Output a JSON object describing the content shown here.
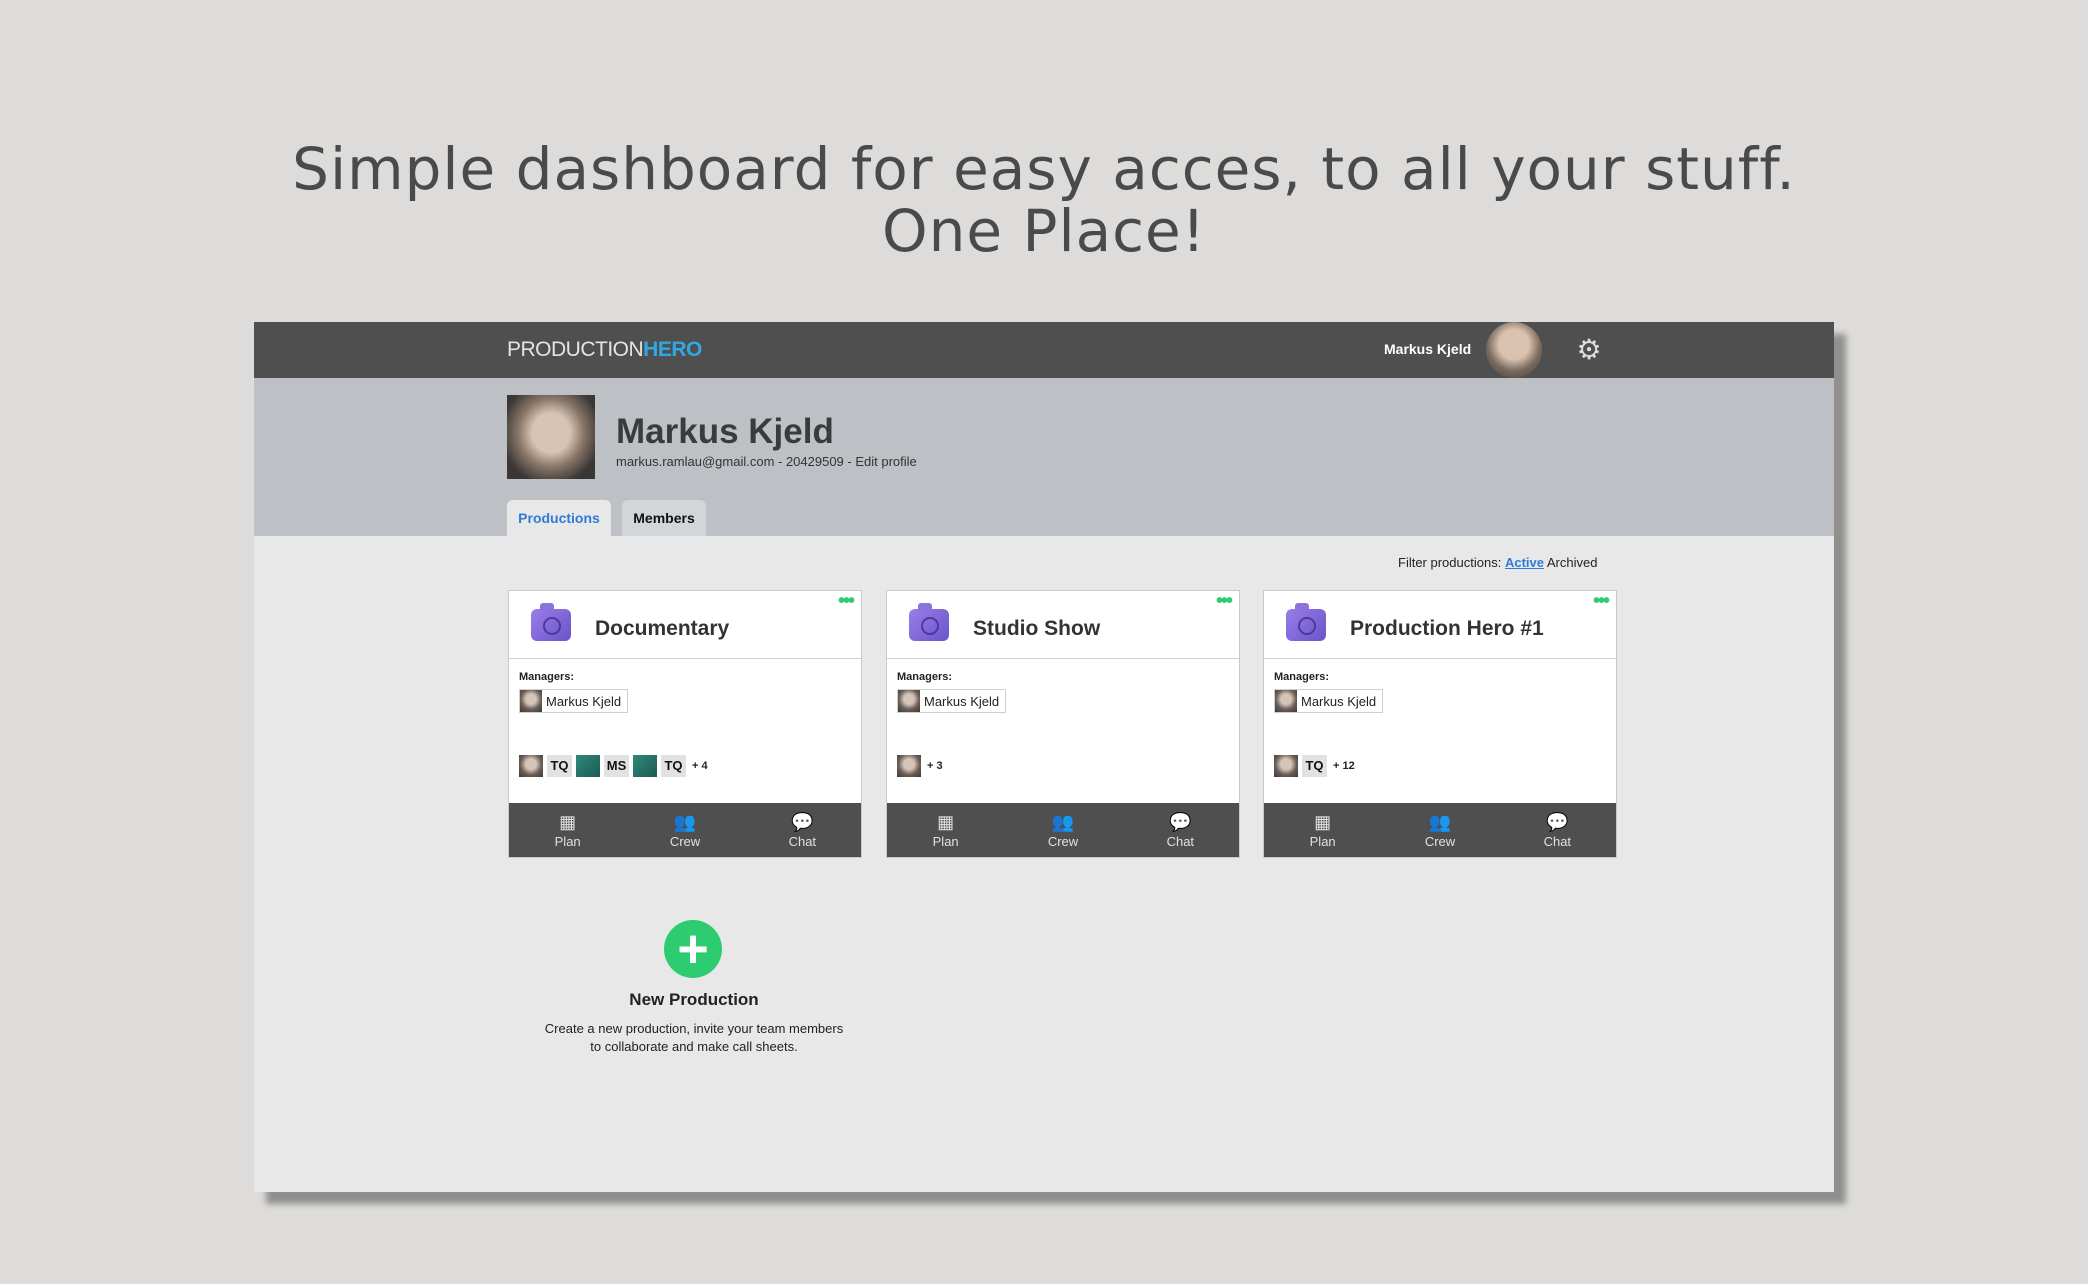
{
  "headline": {
    "line1": "Simple dashboard for easy acces, to all your stuff.",
    "line2": "One Place!"
  },
  "topbar": {
    "logo_part1": "PRODUCTION",
    "logo_part2": "HERO",
    "user_name": "Markus Kjeld",
    "brand_color": "#2ea9e6"
  },
  "profile": {
    "name": "Markus Kjeld",
    "details": "markus.ramlau@gmail.com - 20429509 - Edit profile"
  },
  "tabs": [
    {
      "label": "Productions",
      "active": true
    },
    {
      "label": "Members",
      "active": false
    }
  ],
  "filter": {
    "label": "Filter productions:",
    "active": "Active",
    "archived": "Archived"
  },
  "productions": [
    {
      "title": "Documentary",
      "managers_label": "Managers:",
      "manager": "Markus Kjeld",
      "members": [
        "avatar",
        "TQ",
        "avatar-teal",
        "MS",
        "avatar-teal",
        "TQ"
      ],
      "more": "+ 4"
    },
    {
      "title": "Studio Show",
      "managers_label": "Managers:",
      "manager": "Markus Kjeld",
      "members": [
        "avatar"
      ],
      "more": "+ 3"
    },
    {
      "title": "Production Hero #1",
      "managers_label": "Managers:",
      "manager": "Markus Kjeld",
      "members": [
        "avatar",
        "TQ"
      ],
      "more": "+ 12"
    }
  ],
  "card_actions": {
    "plan": "Plan",
    "crew": "Crew",
    "chat": "Chat"
  },
  "new_production": {
    "title": "New Production",
    "description": "Create a new production, invite your team members to collaborate and make call sheets.",
    "accent": "#2ecc71"
  }
}
